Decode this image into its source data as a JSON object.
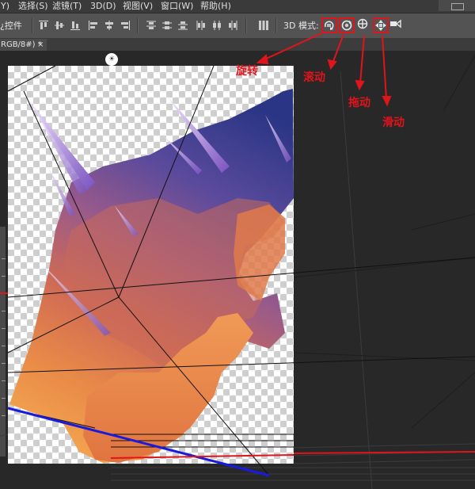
{
  "menubar": {
    "items": [
      "Y)",
      "选择(S)",
      "滤镜(T)",
      "3D(D)",
      "视图(V)",
      "窗口(W)",
      "帮助(H)"
    ]
  },
  "options_bar": {
    "show_controls_label": "¿控件",
    "mode_label": "3D 模式:",
    "align_icons": [
      "align-top-edges-icon",
      "align-vertical-centers-icon",
      "align-bottom-edges-icon",
      "align-left-edges-icon",
      "align-horizontal-centers-icon",
      "align-right-edges-icon"
    ],
    "distribute_icons": [
      "distribute-top-icon",
      "distribute-vcenter-icon",
      "distribute-bottom-icon",
      "distribute-left-icon",
      "distribute-hcenter-icon",
      "distribute-right-icon"
    ],
    "auto_align_icon": "auto-align-layers-icon",
    "modes": [
      {
        "name": "rotate-3d-object",
        "icon": "rotate-3d-icon"
      },
      {
        "name": "roll-3d-object",
        "icon": "roll-3d-icon"
      },
      {
        "name": "drag-3d-object",
        "icon": "drag-3d-icon"
      },
      {
        "name": "slide-3d-object",
        "icon": "slide-3d-icon"
      },
      {
        "name": "scale-3d-object",
        "icon": "scale-3d-icon"
      }
    ]
  },
  "document": {
    "tab_label": "RGB/8#) *",
    "close_glyph": "×"
  },
  "light_widget": {
    "glyph": "☀",
    "icon": "infinite-light-icon"
  },
  "annotations": {
    "rotate": "旋转",
    "roll": "滚动",
    "drag": "拖动",
    "slide": "滑动"
  },
  "colors": {
    "annotation_red": "#e0141b",
    "ground_blue": "#1a1adc",
    "ground_red": "#e0141b",
    "highlight_box": "#e0141b"
  }
}
